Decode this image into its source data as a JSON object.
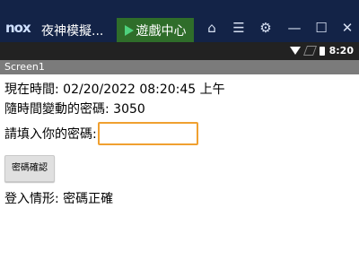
{
  "window": {
    "brand": "nox",
    "title": "夜神模擬...",
    "game_center_tab": "遊戲中心",
    "icons": [
      "home-icon",
      "menu-icon",
      "settings-icon",
      "minimize-icon",
      "maximize-icon",
      "close-icon"
    ]
  },
  "status_bar": {
    "time": "8:20"
  },
  "app": {
    "screen_title": "Screen1"
  },
  "content": {
    "current_time_label": "現在時間:",
    "current_time_value": "02/20/2022 08:20:45 上午",
    "password_label": "隨時間變動的密碼:",
    "password_value": "3050",
    "enter_password_label": "請填入你的密碼:",
    "password_input_value": "",
    "confirm_button": "密碼確認",
    "login_status_label": "登入情形:",
    "login_status_value": "密碼正確"
  },
  "colors": {
    "input_focus": "#f0a030",
    "title_bar": "#132347",
    "game_tab": "#2f6d2a"
  }
}
